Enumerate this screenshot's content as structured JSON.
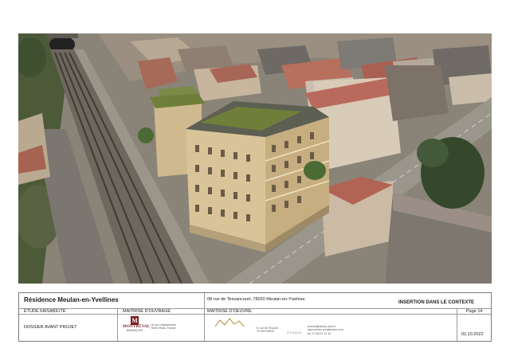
{
  "title_block": {
    "project_name": "Résidence Meulan-en-Yvellines",
    "address": "08 rue de Tessancourt, 78250 Meulan-en-Yvelines",
    "view_title": "INSERTION DANS LE CONTEXTE",
    "phase_label": "ÉTUDE FAISABILITÉ",
    "phase_value": "DOSSIER AVANT PROJET",
    "owner_label": "MAITRISE D'OUVRAGE",
    "owner_logo_text": "MONTRÉVAL",
    "owner_logo_subtext": "IMMOBILIER",
    "owner_logo_letter": "M",
    "owner_contact": [
      "18 rue Lesquelerdes",
      "78000 Paris, France"
    ],
    "architect_label": "MAITRISE D'OEUVRE",
    "architect_logo_text": "STUDIO",
    "architect_contact_a": [
      "8, rue de l'Ecoute",
      "75 000 PARIS"
    ],
    "architect_contact_b": [
      "bureau@studio-arch.fr",
      "www.studio-architecture.com",
      "tel. 07 66 01 12 10"
    ],
    "page": "Page 14",
    "date": "02.10.2022"
  },
  "colors": {
    "border": "#7a7a7a",
    "owner_brand": "#7a1c1c",
    "building_facade": "#d9c49a",
    "green_roof": "#6f7f3a",
    "roof_tiles": "#b96a5c"
  }
}
